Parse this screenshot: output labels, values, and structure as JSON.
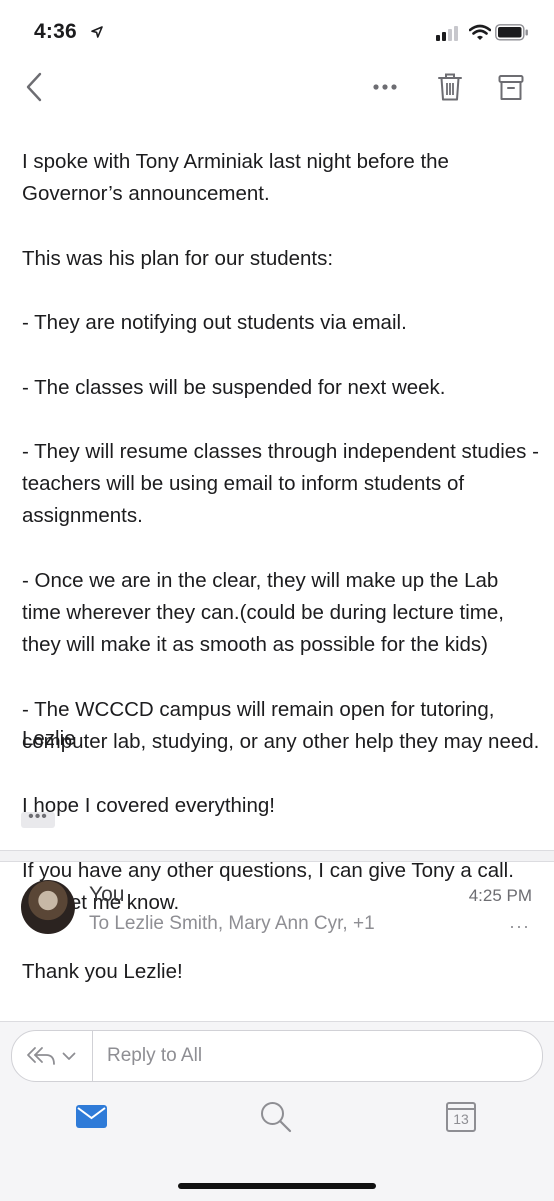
{
  "status_bar": {
    "time": "4:36",
    "icons": [
      "location-arrow-icon",
      "cellular-signal-icon",
      "wifi-icon",
      "battery-icon"
    ]
  },
  "nav": {
    "icons": [
      "back-chevron-icon",
      "more-icon",
      "trash-icon",
      "archive-icon"
    ]
  },
  "email": {
    "body_lines": [
      "I spoke with Tony Arminiak last night before the Governor’s announcement.",
      "This was his plan for our students:",
      "- They are notifying out students via email.",
      "- The classes will be suspended for next week.",
      "- They will resume classes through independent studies - teachers will be using email to inform students of assignments.",
      "- Once we are in the clear, they will make up the Lab time wherever they can.(could be during lecture time, they will make it as smooth as possible for the kids)",
      "- The WCCCD campus will remain open for tutoring, computer lab, studying, or any other help they may need.",
      "I hope I covered everything!",
      "If you have any other questions, I can give Tony a call. Just let me know."
    ],
    "signoff": "Lezlie",
    "more_label": "•••"
  },
  "reply_message": {
    "sender": "You",
    "recipients": "To Lezlie Smith, Mary Ann Cyr, +1",
    "time": "4:25 PM",
    "more_label": "···",
    "body": "Thank you Lezlie!"
  },
  "reply_bar": {
    "placeholder": "Reply to All"
  },
  "tab_bar": {
    "calendar_day": "13",
    "icons": [
      "mail-icon",
      "search-icon",
      "calendar-icon"
    ],
    "accent": "#2f7bd8"
  }
}
